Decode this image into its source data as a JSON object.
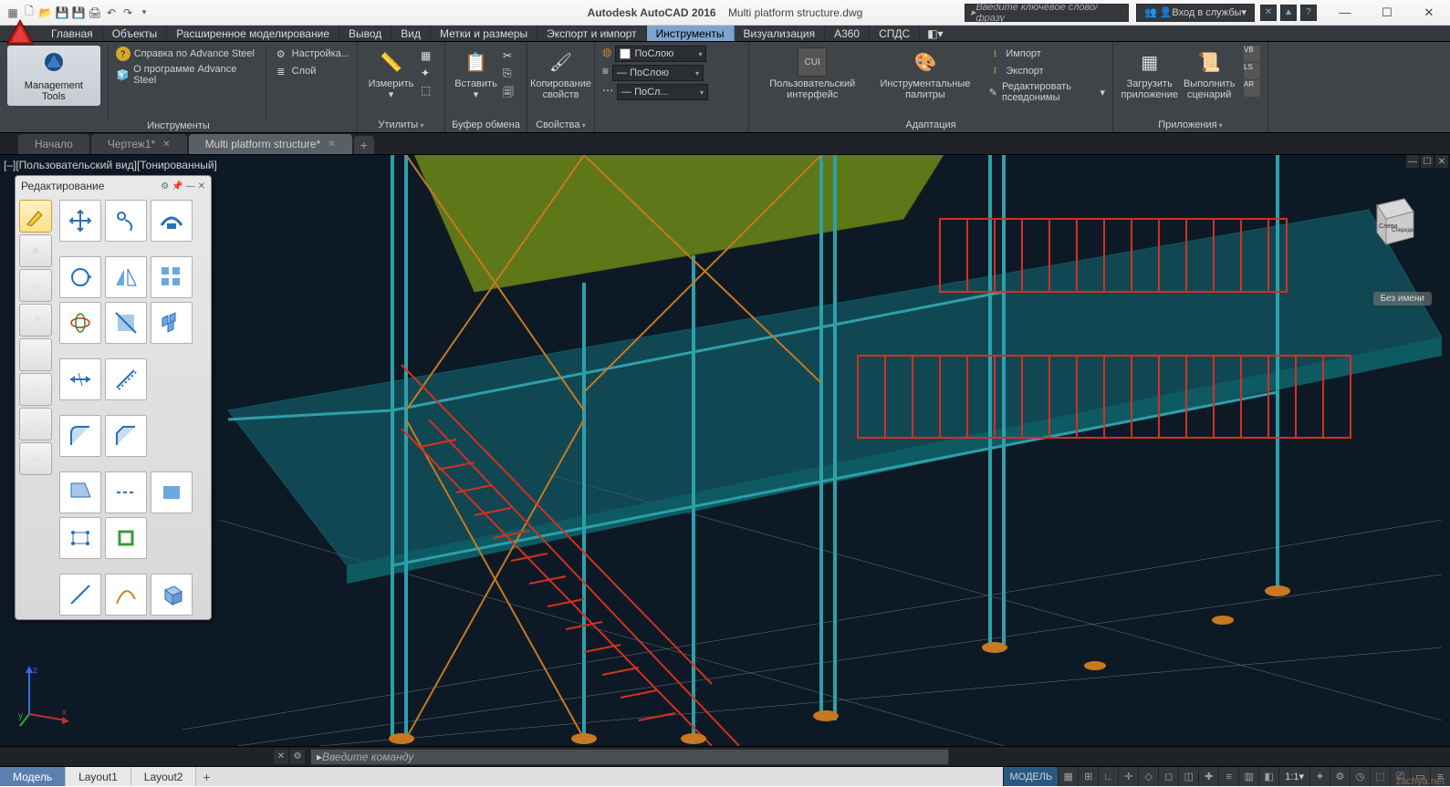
{
  "titlebar": {
    "app_title": "Autodesk AutoCAD 2016",
    "doc_title": "Multi platform structure.dwg",
    "search_placeholder": "Введите ключевое слово/фразу",
    "signin_label": "Вход в службы",
    "win_min": "—",
    "win_max": "☐",
    "win_close": "✕"
  },
  "menu": {
    "tabs": [
      "Главная",
      "Объекты",
      "Расширенное моделирование",
      "Вывод",
      "Вид",
      "Метки и размеры",
      "Экспорт и импорт",
      "Инструменты",
      "Визуализация",
      "A360",
      "СПДС"
    ],
    "active_index": 7
  },
  "ribbon": {
    "panel1_title": "Инструменты",
    "management_tools": "Management\nTools",
    "help_as": "Справка по Advance Steel",
    "about_as": "О программе Advance Steel",
    "settings": "Настройка...",
    "layer": "Слой",
    "panel2_title": "Утилиты",
    "measure": "Измерить",
    "panel3_title": "Буфер обмена",
    "paste": "Вставить",
    "copy_props": "Копирование\nсвойств",
    "panel4_title": "Свойства",
    "bylayer": "ПоСлою",
    "bylayer2": "ПоСлою",
    "bylayer3": "ПоСл...",
    "panel5_title": "Адаптация",
    "cui": "Пользовательский\nинтерфейс",
    "toolpalettes": "Инструментальные\nпалитры",
    "import": "Импорт",
    "export": "Экспорт",
    "edit_aliases": "Редактировать псевдонимы",
    "panel6_title": "Приложения",
    "load_app": "Загрузить\nприложение",
    "run_script": "Выполнить\nсценарий"
  },
  "filetabs": {
    "t0": "Начало",
    "t1": "Чертеж1*",
    "t2": "Multi platform structure*"
  },
  "viewport": {
    "view_label": "[–][Пользовательский вид][Тонированный]",
    "unnamed": "Без имени",
    "cube_left": "Слева",
    "cube_front": "Спереди"
  },
  "float_toolbar": {
    "title": "Редактирование"
  },
  "cmdline": {
    "placeholder": "Введите команду"
  },
  "bottomtabs": {
    "t0": "Модель",
    "t1": "Layout1",
    "t2": "Layout2"
  },
  "status": {
    "model": "МОДЕЛЬ",
    "scale": "1:1",
    "watermark": "zachya.net"
  },
  "ucs": {
    "x": "x",
    "y": "y",
    "z": "z"
  }
}
